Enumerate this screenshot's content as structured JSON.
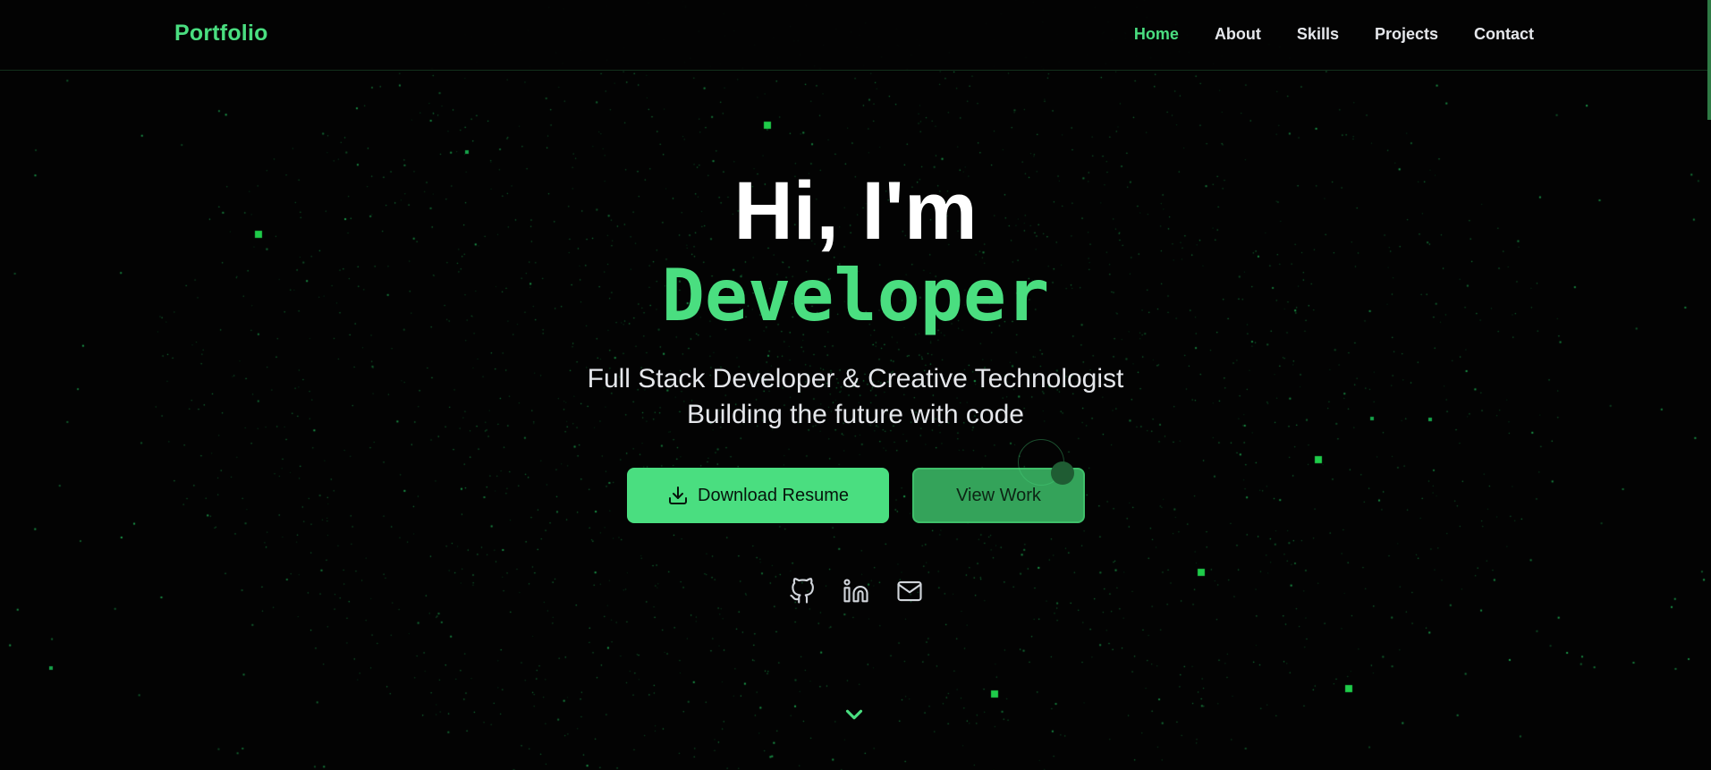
{
  "brand": "Portfolio",
  "nav": [
    {
      "label": "Home",
      "active": true
    },
    {
      "label": "About",
      "active": false
    },
    {
      "label": "Skills",
      "active": false
    },
    {
      "label": "Projects",
      "active": false
    },
    {
      "label": "Contact",
      "active": false
    }
  ],
  "hero": {
    "greeting": "Hi, I'm",
    "name": "Developer",
    "subtitle_line1": "Full Stack Developer & Creative Technologist",
    "subtitle_line2": "Building the future with code",
    "primary_button": "Download Resume",
    "secondary_button": "View Work"
  },
  "socials": [
    {
      "icon": "github-icon"
    },
    {
      "icon": "linkedin-icon"
    },
    {
      "icon": "mail-icon"
    }
  ],
  "colors": {
    "background": "#030303",
    "accent": "#4ade80",
    "text": "#e5e7eb",
    "secondary_button": "#34a35a"
  },
  "icons": {
    "download": "download-icon",
    "scroll": "chevron-down-icon"
  }
}
